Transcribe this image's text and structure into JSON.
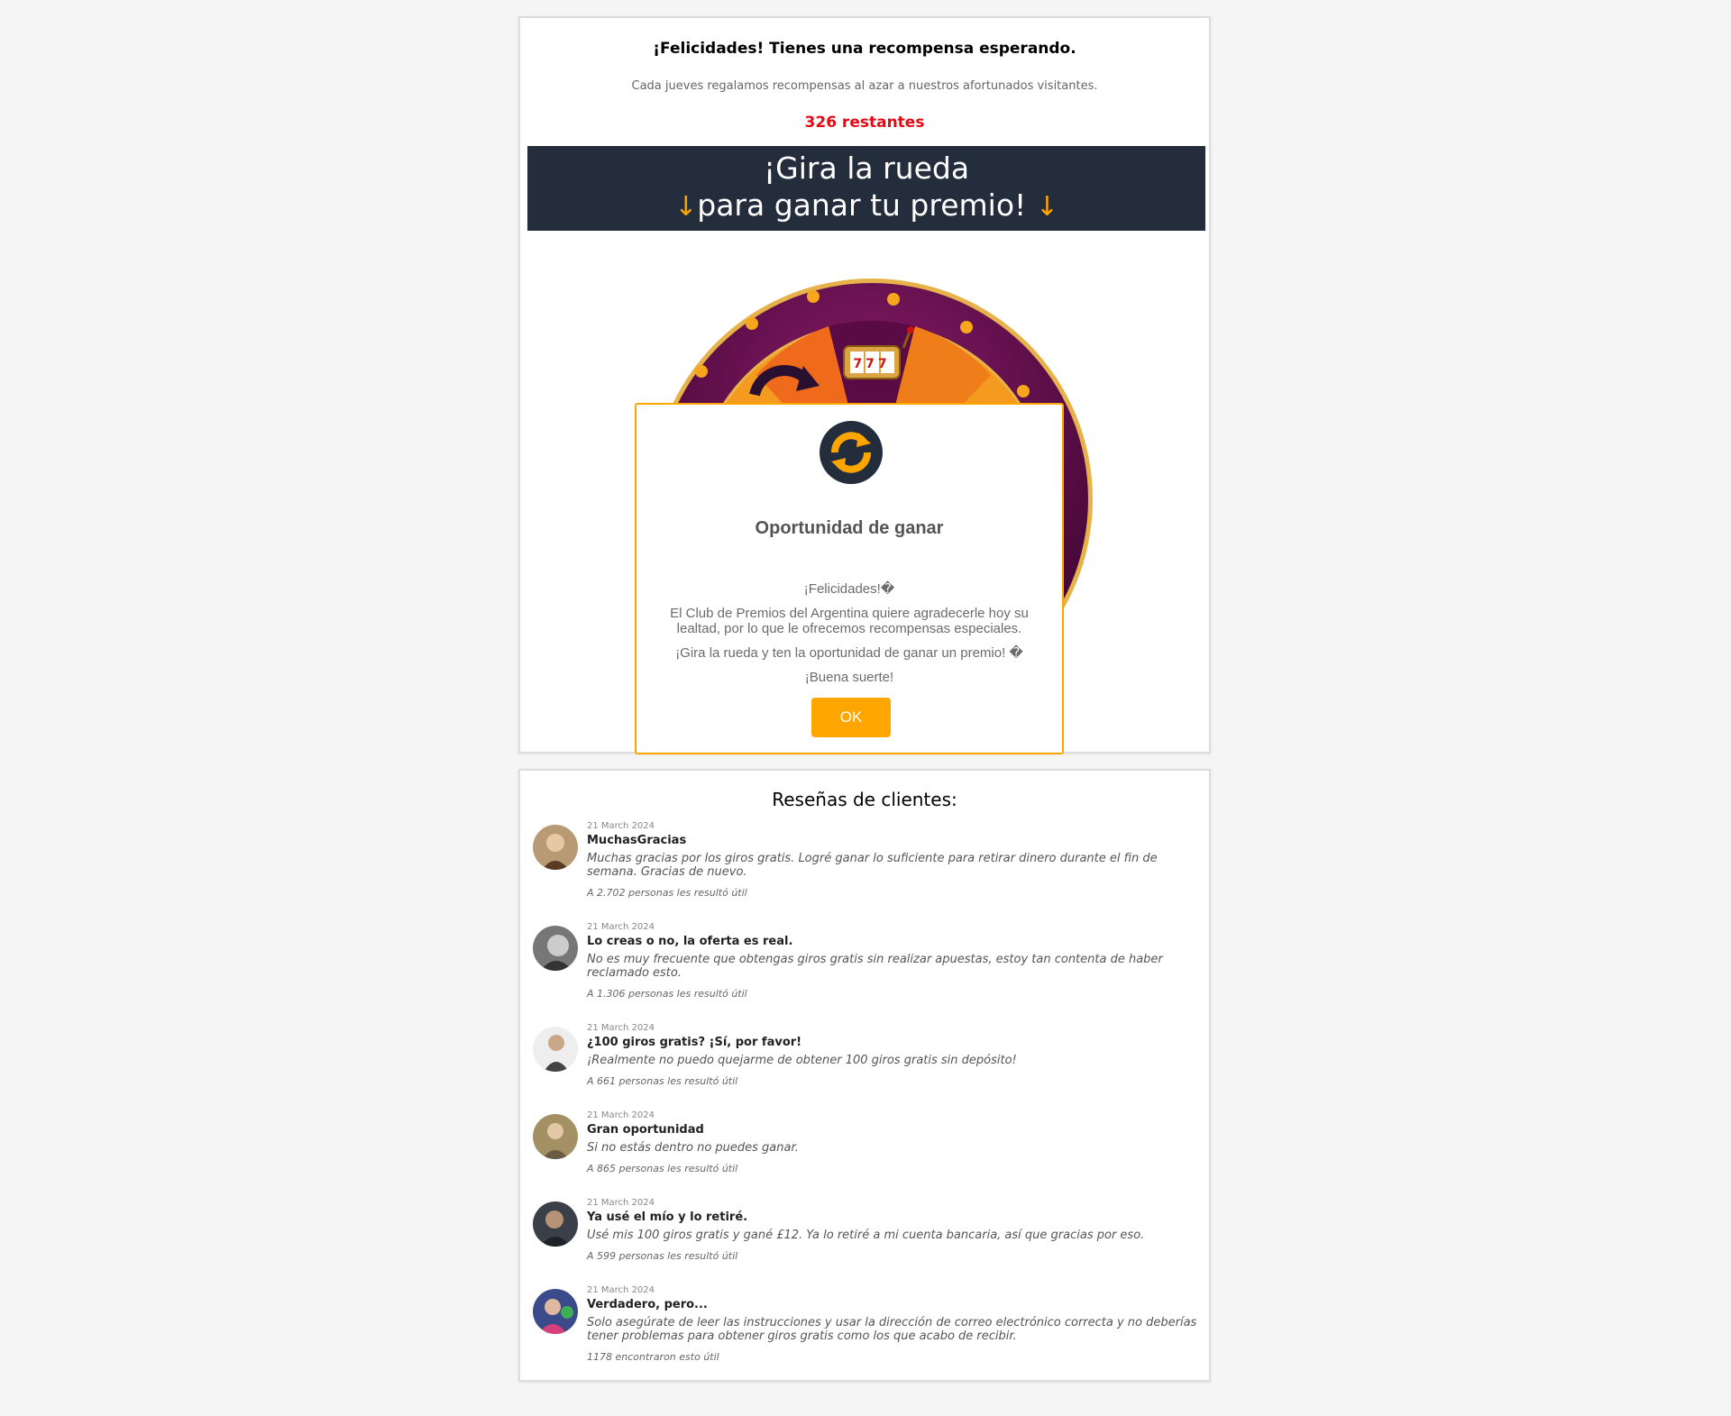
{
  "header": {
    "title": "¡Felicidades! Tienes una recompensa esperando.",
    "subtitle": "Cada jueves regalamos recompensas al azar a nuestros afortunados visitantes.",
    "remaining": "326 restantes"
  },
  "banner": {
    "line1": "¡Gira la rueda",
    "line2": "para ganar tu premio!",
    "arrow": "↓"
  },
  "wheel": {
    "slot_label": "777"
  },
  "modal": {
    "title": "Oportunidad de ganar",
    "greeting": "¡Felicidades!�",
    "message": "El Club de Premios del Argentina quiere agradecerle hoy su lealtad, por lo que le ofrecemos recompensas especiales.",
    "cta": "¡Gira la rueda y ten la oportunidad de ganar un premio! �",
    "luck": "¡Buena suerte!",
    "ok_label": "OK"
  },
  "reviews": {
    "heading": "Reseñas de clientes:",
    "items": [
      {
        "date": "21 March 2024",
        "name": "MuchasGracias",
        "text": "Muchas gracias por los giros gratis. Logré ganar lo suficiente para retirar dinero durante el fin de semana. Gracias de nuevo.",
        "helpful": "A 2.702 personas les resultó útil"
      },
      {
        "date": "21 March 2024",
        "name": "Lo creas o no, la oferta es real.",
        "text": "No es muy frecuente que obtengas giros gratis sin realizar apuestas, estoy tan contenta de haber reclamado esto.",
        "helpful": "A 1.306 personas les resultó útil"
      },
      {
        "date": "21 March 2024",
        "name": "¿100 giros gratis? ¡Sí, por favor!",
        "text": "¡Realmente no puedo quejarme de obtener 100 giros gratis sin depósito!",
        "helpful": "A 661 personas les resultó útil"
      },
      {
        "date": "21 March 2024",
        "name": "Gran oportunidad",
        "text": "Si no estás dentro no puedes ganar.",
        "helpful": "A 865 personas les resultó útil"
      },
      {
        "date": "21 March 2024",
        "name": "Ya usé el mío y lo retiré.",
        "text": "Usé mis 100 giros gratis y gané £12. Ya lo retiré a mi cuenta bancaria, así que gracias por eso.",
        "helpful": "A 599 personas les resultó útil"
      },
      {
        "date": "21 March 2024",
        "name": "Verdadero, pero...",
        "text": "Solo asegúrate de leer las instrucciones y usar la dirección de correo electrónico correcta y no deberías tener problemas para obtener giros gratis como los que acabo de recibir.",
        "helpful": "1178 encontraron esto útil"
      }
    ]
  },
  "colors": {
    "accent": "#ffa500",
    "banner_bg": "#232d3b",
    "remaining_red": "#e50914",
    "wheel_purple": "#5a0a45"
  },
  "icons": [
    "refresh-icon",
    "slot-machine-icon",
    "arrow-down-icon"
  ]
}
